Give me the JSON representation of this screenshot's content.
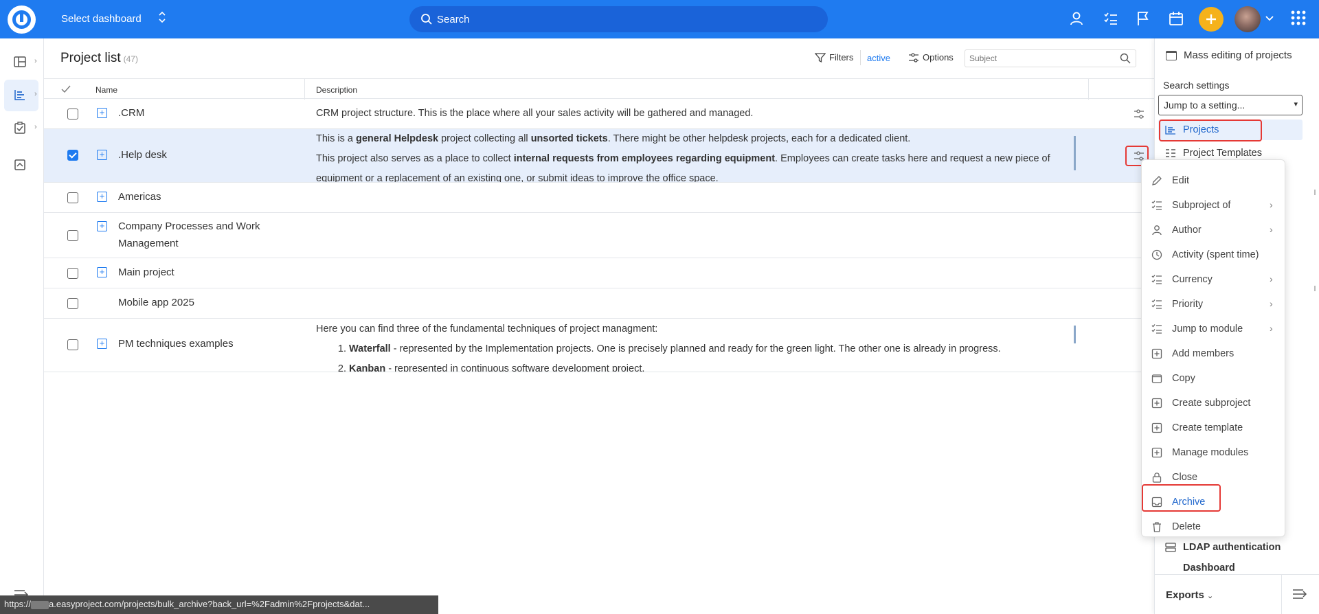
{
  "topbar": {
    "dashboard_label": "Select dashboard",
    "search_placeholder": "Search"
  },
  "main": {
    "title": "Project list",
    "count": "(47)",
    "filters_label": "Filters",
    "filters_state": "active",
    "options_label": "Options",
    "subject_placeholder": "Subject",
    "columns": {
      "name": "Name",
      "description": "Description"
    },
    "rows": [
      {
        "name": ".CRM",
        "desc": "CRM project structure. This is the place where all your sales activity will be gathered and managed."
      },
      {
        "name": ".Help desk",
        "selected": true,
        "desc_parts": [
          "This is a ",
          "general Helpdesk",
          " project collecting all ",
          "unsorted tickets",
          ". There might be other helpdesk projects, each for a dedicated client."
        ],
        "desc2_parts": [
          "This project also serves as a place to collect ",
          "internal requests from employees regarding equipment",
          ". Employees can create tasks here and request a new piece of"
        ],
        "desc3": "equipment or a replacement of an existing one, or submit ideas to improve the office space."
      },
      {
        "name": "Americas",
        "desc": ""
      },
      {
        "name_line1": "Company Processes and Work",
        "name_line2": "Management",
        "desc": ""
      },
      {
        "name": "Main project",
        "desc": ""
      },
      {
        "name": "Mobile app 2025",
        "desc": ""
      },
      {
        "name": "PM techniques examples",
        "desc_intro": "Here you can find three of the fundamental techniques of project managment:",
        "list": [
          {
            "bold": "Waterfall",
            "text": " - represented by the Implementation projects. One is precisely planned and ready for the green light. The other one is already in progress."
          },
          {
            "bold": "Kanban",
            "text": " - represented in continuous software development project."
          }
        ]
      }
    ]
  },
  "right_panel": {
    "mass_editing": "Mass editing of projects",
    "search_settings": "Search settings",
    "jump_select": "Jump to a setting...",
    "items": [
      "Projects",
      "Project Templates"
    ],
    "lower_items": [
      "LDAP authentication",
      "Dashboard"
    ],
    "exports": "Exports"
  },
  "context_menu": {
    "items": [
      {
        "label": "Edit",
        "icon": "pencil-icon",
        "submenu": false
      },
      {
        "label": "Subproject of",
        "icon": "list-icon",
        "submenu": true
      },
      {
        "label": "Author",
        "icon": "person-icon",
        "submenu": true
      },
      {
        "label": "Activity (spent time)",
        "icon": "clock-icon",
        "submenu": false
      },
      {
        "label": "Currency",
        "icon": "list-icon",
        "submenu": true
      },
      {
        "label": "Priority",
        "icon": "list-icon",
        "submenu": true
      },
      {
        "label": "Jump to module",
        "icon": "list-icon",
        "submenu": true
      },
      {
        "label": "Add members",
        "icon": "plus-box-icon",
        "submenu": false
      },
      {
        "label": "Copy",
        "icon": "copy-icon",
        "submenu": false
      },
      {
        "label": "Create subproject",
        "icon": "plus-box-icon",
        "submenu": false
      },
      {
        "label": "Create template",
        "icon": "plus-box-icon",
        "submenu": false
      },
      {
        "label": "Manage modules",
        "icon": "plus-box-icon",
        "submenu": false
      },
      {
        "label": "Close",
        "icon": "lock-icon",
        "submenu": false
      },
      {
        "label": "Archive",
        "icon": "archive-icon",
        "submenu": false
      },
      {
        "label": "Delete",
        "icon": "trash-icon",
        "submenu": false
      }
    ]
  },
  "statusbar": {
    "url_prefix": "https://",
    "url_rest": "a.easyproject.com/projects/bulk_archive?back_url=%2Fadmin%2Fprojects&dat..."
  },
  "colors": {
    "brand": "#1f7bf0",
    "accent": "#f5b21b",
    "highlight": "#e53935"
  }
}
